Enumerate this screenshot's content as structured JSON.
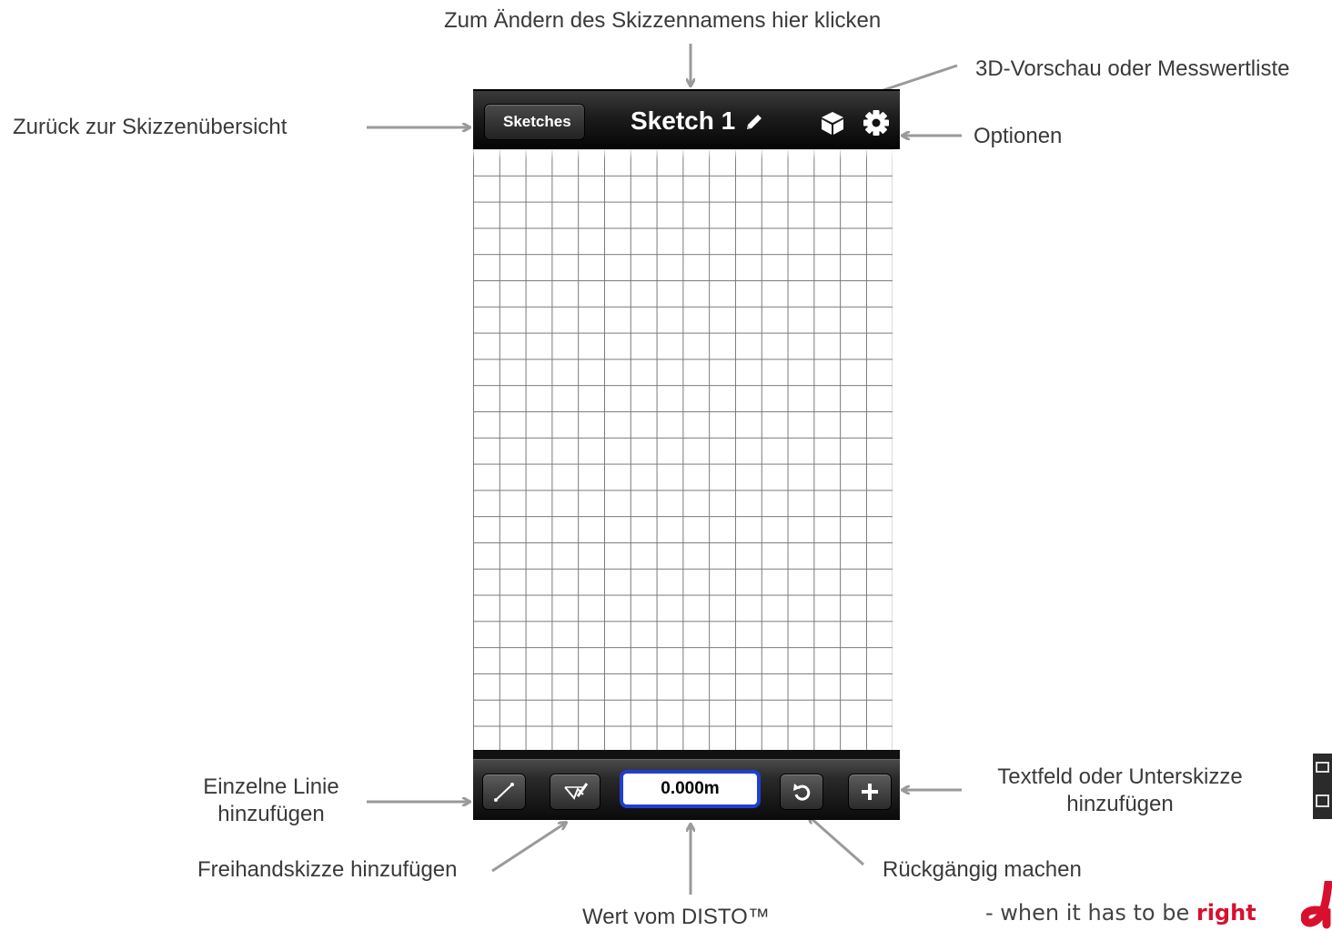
{
  "annotations": {
    "rename_hint": "Zum Ändern des Skizzennamens hier klicken",
    "preview_hint": "3D-Vorschau oder Messwertliste",
    "back_hint": "Zurück zur Skizzenübersicht",
    "options_hint": "Optionen",
    "single_line_hint_1": "Einzelne Linie",
    "single_line_hint_2": "hinzufügen",
    "textfield_hint_1": "Textfeld oder Unterskizze",
    "textfield_hint_2": "hinzufügen",
    "freehand_hint": "Freihandskizze hinzufügen",
    "undo_hint": "Rückgängig machen",
    "disto_hint": "Wert vom DISTO™"
  },
  "navbar": {
    "back_label": "Sketches",
    "title": "Sketch 1",
    "icons": [
      "pencil-icon",
      "cube-icon",
      "gear-icon"
    ]
  },
  "toolbar": {
    "disto_value": "0.000m",
    "icons": [
      "line-icon",
      "freehand-icon",
      "undo-icon",
      "plus-icon"
    ]
  },
  "tagline": {
    "prefix": "- when it has to be",
    "emphasis": "right"
  },
  "colors": {
    "arrow": "#9a9a9a",
    "field_border": "#1f3fd1",
    "brand_red": "#d8102e"
  }
}
